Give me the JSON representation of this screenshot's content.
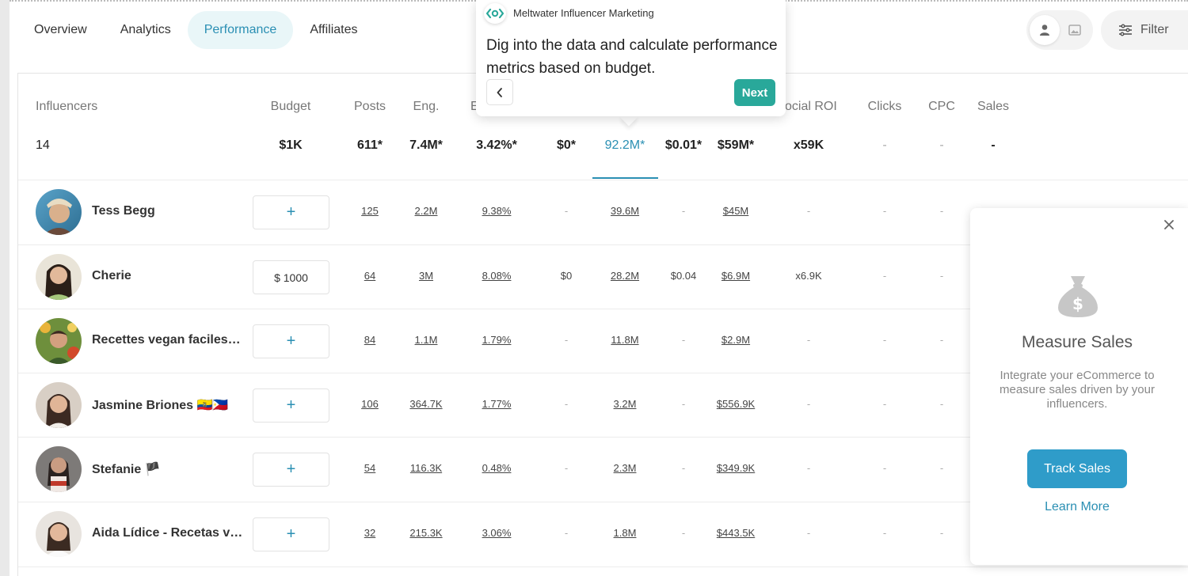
{
  "tabs": [
    {
      "label": "Overview",
      "active": false
    },
    {
      "label": "Analytics",
      "active": false
    },
    {
      "label": "Performance",
      "active": true
    },
    {
      "label": "Affiliates",
      "active": false
    }
  ],
  "toolbar": {
    "filter_label": "Filter",
    "view_icons": [
      "person-icon",
      "image-icon"
    ]
  },
  "table": {
    "headers": {
      "influencers": "Influencers",
      "budget": "Budget",
      "posts": "Posts",
      "eng": "Eng.",
      "eng_rate": "E",
      "social_roi": "ocial ROI",
      "clicks": "Clicks",
      "cpc": "CPC",
      "sales": "Sales"
    },
    "totals": {
      "count": "14",
      "budget": "$1K",
      "posts": "611*",
      "eng": "7.4M*",
      "eng_rate": "3.42%*",
      "cost": "$0*",
      "reach": "92.2M*",
      "cpe": "$0.01*",
      "value": "$59M*",
      "roi": "x59K",
      "clicks": "-",
      "cpc": "-",
      "sales": "-"
    },
    "rows": [
      {
        "name": "Tess Begg",
        "budget": "+",
        "posts": "125",
        "eng": "2.2M",
        "rate": "9.38%",
        "cost": "-",
        "reach": "39.6M",
        "cpe": "-",
        "value": "$45M",
        "roi": "-",
        "clicks": "-",
        "cpc": "-"
      },
      {
        "name": "Cherie",
        "budget": "$ 1000",
        "posts": "64",
        "eng": "3M",
        "rate": "8.08%",
        "cost": "$0",
        "reach": "28.2M",
        "cpe": "$0.04",
        "value": "$6.9M",
        "roi": "x6.9K",
        "clicks": "-",
        "cpc": "-"
      },
      {
        "name": "Recettes vegan faciles…",
        "budget": "+",
        "posts": "84",
        "eng": "1.1M",
        "rate": "1.79%",
        "cost": "-",
        "reach": "11.8M",
        "cpe": "-",
        "value": "$2.9M",
        "roi": "-",
        "clicks": "-",
        "cpc": "-"
      },
      {
        "name": "Jasmine Briones 🇪🇨🇵🇭",
        "budget": "+",
        "posts": "106",
        "eng": "364.7K",
        "rate": "1.77%",
        "cost": "-",
        "reach": "3.2M",
        "cpe": "-",
        "value": "$556.9K",
        "roi": "-",
        "clicks": "-",
        "cpc": "-"
      },
      {
        "name": "Stefanie 🏴",
        "budget": "+",
        "posts": "54",
        "eng": "116.3K",
        "rate": "0.48%",
        "cost": "-",
        "reach": "2.3M",
        "cpe": "-",
        "value": "$349.9K",
        "roi": "-",
        "clicks": "-",
        "cpc": "-"
      },
      {
        "name": "Aida Lídice - Recetas v…",
        "budget": "+",
        "posts": "32",
        "eng": "215.3K",
        "rate": "3.06%",
        "cost": "-",
        "reach": "1.8M",
        "cpe": "-",
        "value": "$443.5K",
        "roi": "-",
        "clicks": "-",
        "cpc": "-"
      }
    ]
  },
  "tour": {
    "brand": "Meltwater Influencer Marketing",
    "message": "Dig into the data and calculate performance metrics based on budget.",
    "next_label": "Next",
    "accent": "#29a89a"
  },
  "sales_panel": {
    "title": "Measure Sales",
    "text": "Integrate your eCommerce to measure sales driven by your influencers.",
    "button_label": "Track Sales",
    "link_label": "Learn More",
    "accent": "#2f9cc9"
  }
}
